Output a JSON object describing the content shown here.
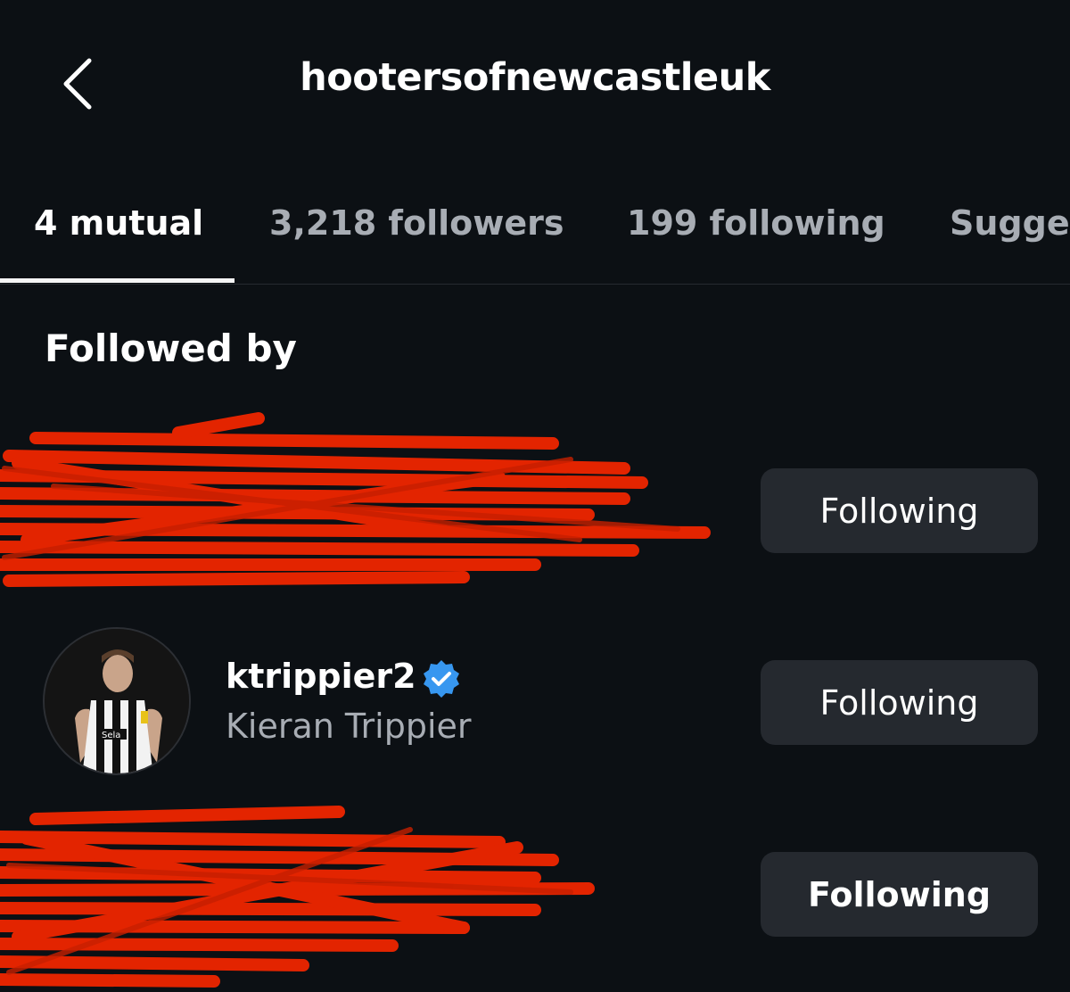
{
  "header": {
    "title": "hootersofnewcastleuk",
    "back_icon": "chevron-left-icon"
  },
  "tabs": [
    {
      "label": "4 mutual",
      "active": true
    },
    {
      "label": "3,218 followers",
      "active": false
    },
    {
      "label": "199 following",
      "active": false
    },
    {
      "label": "Sugge",
      "active": false
    }
  ],
  "section": {
    "title": "Followed by"
  },
  "users": [
    {
      "username": "",
      "full_name": "",
      "redacted": true,
      "button_label": "Following"
    },
    {
      "username": "ktrippier2",
      "full_name": "Kieran Trippier",
      "verified": true,
      "button_label": "Following"
    },
    {
      "username": "",
      "full_name": "",
      "redacted": true,
      "button_label": "Following"
    }
  ],
  "colors": {
    "background": "#0c1014",
    "button": "#25292f",
    "secondary_text": "#a8adb4",
    "verified_badge": "#3797f0",
    "redaction": "#e32400"
  }
}
